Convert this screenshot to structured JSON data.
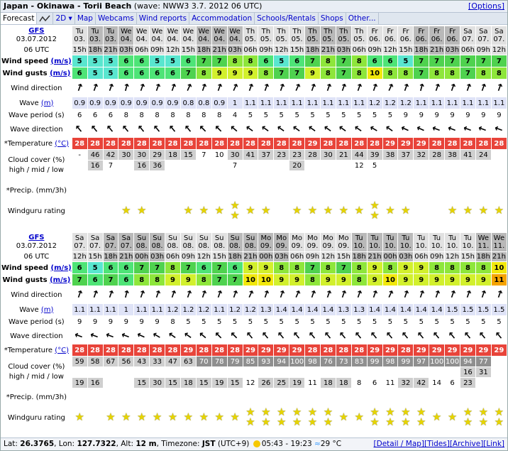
{
  "header": {
    "title_bold": "Japan - Okinawa - Torii Beach",
    "title_rest": "(wave: NWW3 3.7. 2012 06 UTC)",
    "options": "[Options]"
  },
  "tabs": [
    "Forecast",
    "2D",
    "Map",
    "Webcams",
    "Wind reports",
    "Accommodation",
    "Schools/Rentals",
    "Shops",
    "Other..."
  ],
  "labels": {
    "model": "GFS",
    "init_date": "03.07.2012",
    "init_time": "06 UTC",
    "wind_speed": "Wind speed",
    "wind_gusts": "Wind gusts",
    "ms": "(m/s)",
    "wind_direction": "Wind direction",
    "wave": "Wave",
    "m": "(m)",
    "wave_period": "Wave period (s)",
    "wave_direction": "Wave direction",
    "temperature": "*Temperature",
    "degc": "(°C)",
    "cloud1": "Cloud cover (%)",
    "cloud2": "high / mid / low",
    "precip": "*Precip. (mm/3h)",
    "rating": "Windguru rating"
  },
  "blocks": [
    {
      "days": [
        "Tu 03.",
        "Tu 03.",
        "Tu 03.",
        "We 04.",
        "We 04.",
        "We 04.",
        "We 04.",
        "We 04.",
        "We 04.",
        "We 04.",
        "We 04.",
        "Th 05.",
        "Th 05.",
        "Th 05.",
        "Th 05.",
        "Th 05.",
        "Th 05.",
        "Th 05.",
        "Th 05.",
        "Fr 06.",
        "Fr 06.",
        "Fr 06.",
        "Fr 06.",
        "Fr 06.",
        "Fr 06.",
        "Sa 07.",
        "Sa 07.",
        "Sa 07."
      ],
      "hours": [
        "15h",
        "18h",
        "21h",
        "03h",
        "06h",
        "09h",
        "12h",
        "15h",
        "18h",
        "21h",
        "03h",
        "06h",
        "09h",
        "12h",
        "15h",
        "18h",
        "21h",
        "03h",
        "06h",
        "09h",
        "12h",
        "15h",
        "18h",
        "21h",
        "03h",
        "06h",
        "09h",
        "12h"
      ],
      "wind_speed": [
        5,
        5,
        5,
        6,
        6,
        5,
        5,
        6,
        7,
        7,
        8,
        8,
        6,
        5,
        6,
        7,
        8,
        7,
        8,
        6,
        6,
        5,
        7,
        7,
        7,
        7,
        7,
        7
      ],
      "wind_gusts": [
        6,
        5,
        5,
        6,
        6,
        6,
        6,
        7,
        8,
        9,
        9,
        9,
        8,
        7,
        7,
        9,
        8,
        7,
        8,
        10,
        8,
        8,
        7,
        8,
        8,
        7,
        8,
        8
      ],
      "wind_dir": [
        20,
        20,
        20,
        15,
        20,
        20,
        20,
        25,
        20,
        20,
        25,
        20,
        20,
        20,
        25,
        20,
        20,
        20,
        20,
        20,
        25,
        20,
        15,
        20,
        20,
        20,
        20,
        20
      ],
      "wave": [
        "0.9",
        "0.9",
        "0.9",
        "0.9",
        "0.9",
        "0.9",
        "0.9",
        "0.8",
        "0.8",
        "0.9",
        "1",
        "1.1",
        "1.1",
        "1.1",
        "1.1",
        "1.1",
        "1.1",
        "1.1",
        "1.1",
        "1.2",
        "1.2",
        "1.2",
        "1.1",
        "1.1",
        "1.1",
        "1.1",
        "1.1",
        "1.1"
      ],
      "wave_period": [
        "6",
        "6",
        "6",
        "8",
        "8",
        "8",
        "8",
        "8",
        "8",
        "8",
        "4",
        "5",
        "5",
        "5",
        "5",
        "5",
        "5",
        "5",
        "5",
        "5",
        "5",
        "9",
        "9",
        "9",
        "9",
        "9",
        "9",
        "9"
      ],
      "wave_dir": [
        -40,
        -40,
        -40,
        -40,
        -40,
        -40,
        -40,
        -40,
        -45,
        -45,
        -50,
        -55,
        -55,
        -55,
        -55,
        -55,
        -55,
        -55,
        -55,
        -60,
        -55,
        -65,
        -65,
        -70,
        -70,
        -70,
        -70,
        -70
      ],
      "temperature": [
        "28",
        "28",
        "28",
        "28",
        "28",
        "28",
        "28",
        "28",
        "28",
        "28",
        "28",
        "28",
        "28",
        "28",
        "28",
        "29",
        "28",
        "28",
        "28",
        "28",
        "29",
        "29",
        "29",
        "28",
        "28",
        "28",
        "28",
        "28"
      ],
      "cloud_high": [
        "-",
        "46",
        "42",
        "30",
        "30",
        "29",
        "18",
        "15",
        "7",
        "10",
        "30",
        "41",
        "37",
        "23",
        "23",
        "28",
        "30",
        "21",
        "44",
        "39",
        "38",
        "37",
        "32",
        "28",
        "38",
        "41",
        "24",
        ""
      ],
      "cloud_mid": [
        "",
        "16",
        "7",
        "",
        "16",
        "36",
        "",
        "",
        "",
        "",
        "7",
        "",
        "",
        "",
        "20",
        "",
        "",
        "",
        "12",
        "5",
        "",
        "",
        "",
        "",
        "",
        "",
        "",
        ""
      ],
      "cloud_low": [
        "",
        "",
        "",
        "",
        "",
        "",
        "",
        "",
        "",
        "",
        "",
        "",
        "",
        "",
        "",
        "",
        "",
        "",
        "",
        "",
        "",
        "",
        "",
        "",
        "",
        "",
        "",
        ""
      ],
      "precip": [
        "",
        "",
        "",
        "",
        "",
        "",
        "",
        "",
        "",
        "",
        "",
        "",
        "",
        "",
        "",
        "",
        "",
        "",
        "",
        "",
        "",
        "",
        "",
        "",
        "",
        "",
        "",
        ""
      ],
      "rating": [
        0,
        0,
        0,
        1,
        1,
        0,
        0,
        1,
        1,
        1,
        2,
        1,
        1,
        0,
        1,
        1,
        1,
        1,
        1,
        2,
        1,
        1,
        0,
        0,
        1,
        1,
        1,
        1
      ]
    },
    {
      "days": [
        "Sa 07.",
        "Sa 07.",
        "Sa 07.",
        "Sa 07.",
        "Su 08.",
        "Su 08.",
        "Su 08.",
        "Su 08.",
        "Su 08.",
        "Su 08.",
        "Su 08.",
        "Su 08.",
        "Mo 09.",
        "Mo 09.",
        "Mo 09.",
        "Mo 09.",
        "Mo 09.",
        "Mo 09.",
        "Tu 10.",
        "Tu 10.",
        "Tu 10.",
        "Tu 10.",
        "Tu 10.",
        "Tu 10.",
        "Tu 10.",
        "Tu 10.",
        "We 11.",
        "We 11."
      ],
      "hours": [
        "12h",
        "15h",
        "18h",
        "21h",
        "00h",
        "03h",
        "06h",
        "09h",
        "12h",
        "15h",
        "18h",
        "21h",
        "00h",
        "03h",
        "06h",
        "09h",
        "12h",
        "15h",
        "18h",
        "21h",
        "00h",
        "03h",
        "06h",
        "09h",
        "12h",
        "15h",
        "18h",
        "21h"
      ],
      "wind_speed": [
        6,
        5,
        6,
        6,
        7,
        7,
        8,
        7,
        6,
        7,
        6,
        9,
        9,
        8,
        8,
        7,
        8,
        7,
        8,
        9,
        8,
        9,
        9,
        8,
        8,
        8,
        8,
        10
      ],
      "wind_gusts": [
        7,
        6,
        7,
        6,
        8,
        8,
        9,
        9,
        8,
        7,
        7,
        10,
        10,
        9,
        9,
        8,
        9,
        9,
        8,
        9,
        10,
        9,
        9,
        9,
        9,
        9,
        9,
        11
      ],
      "wind_dir": [
        20,
        20,
        20,
        15,
        20,
        20,
        20,
        20,
        20,
        20,
        20,
        25,
        20,
        20,
        25,
        20,
        20,
        20,
        20,
        20,
        25,
        20,
        20,
        20,
        20,
        20,
        20,
        20
      ],
      "wave": [
        "1.1",
        "1.1",
        "1.1",
        "1",
        "1.1",
        "1.1",
        "1.2",
        "1.2",
        "1.2",
        "1.1",
        "1.2",
        "1.2",
        "1.3",
        "1.4",
        "1.4",
        "1.4",
        "1.4",
        "1.3",
        "1.3",
        "1.4",
        "1.4",
        "1.4",
        "1.4",
        "1.4",
        "1.5",
        "1.5",
        "1.5",
        "1.5"
      ],
      "wave_period": [
        "9",
        "9",
        "9",
        "9",
        "9",
        "9",
        "8",
        "5",
        "5",
        "5",
        "5",
        "5",
        "5",
        "5",
        "5",
        "5",
        "5",
        "5",
        "5",
        "5",
        "5",
        "5",
        "5",
        "5",
        "5",
        "5",
        "5",
        "5"
      ],
      "wave_dir": [
        -70,
        -70,
        -70,
        -70,
        -65,
        -60,
        -55,
        -55,
        -50,
        -45,
        -45,
        -40,
        -40,
        -40,
        -40,
        -40,
        -40,
        -40,
        -40,
        -40,
        -40,
        -40,
        -40,
        -40,
        -40,
        -40,
        -40,
        -40
      ],
      "temperature": [
        "28",
        "28",
        "28",
        "28",
        "28",
        "28",
        "28",
        "29",
        "28",
        "28",
        "28",
        "29",
        "29",
        "29",
        "29",
        "28",
        "28",
        "28",
        "28",
        "29",
        "29",
        "28",
        "29",
        "29",
        "29",
        "29",
        "29",
        "29"
      ],
      "cloud_high": [
        "59",
        "58",
        "67",
        "56",
        "43",
        "33",
        "47",
        "63",
        "70",
        "78",
        "79",
        "85",
        "93",
        "94",
        "100",
        "98",
        "76",
        "73",
        "83",
        "99",
        "98",
        "99",
        "97",
        "100",
        "100",
        "94",
        "77",
        ""
      ],
      "cloud_mid": [
        "",
        "",
        "",
        "",
        "",
        "",
        "",
        "",
        "",
        "",
        "",
        "",
        "",
        "",
        "",
        "",
        "",
        "",
        "",
        "",
        "",
        "",
        "",
        "",
        "",
        "16",
        "31",
        ""
      ],
      "cloud_low": [
        "19",
        "16",
        "",
        "",
        "15",
        "30",
        "15",
        "18",
        "15",
        "19",
        "15",
        "12",
        "26",
        "25",
        "19",
        "11",
        "18",
        "18",
        "8",
        "6",
        "11",
        "32",
        "42",
        "14",
        "6",
        "23",
        "",
        ""
      ],
      "precip": [
        "",
        "",
        "",
        "",
        "",
        "",
        "",
        "",
        "",
        "",
        "",
        "",
        "",
        "",
        "",
        "",
        "",
        "",
        "",
        "",
        "",
        "",
        "",
        "",
        "",
        "",
        "",
        ""
      ],
      "rating": [
        1,
        0,
        1,
        1,
        1,
        1,
        1,
        1,
        1,
        1,
        1,
        2,
        2,
        2,
        2,
        2,
        2,
        1,
        1,
        2,
        2,
        2,
        2,
        1,
        1,
        2,
        2,
        2
      ]
    }
  ],
  "footer": {
    "lat_label": "Lat:",
    "lat": "26.3765",
    "lon_label": ", Lon:",
    "lon": "127.7322",
    "alt_label": ", Alt:",
    "alt": "12 m",
    "tz_label": ", Timezone:",
    "tz": "JST",
    "tz_off": "(UTC+9)",
    "sun": "05:43 - 19:23",
    "sea": "29 °C",
    "links": [
      "[Detail / Map]",
      "[Tides]",
      "[Archive]",
      "[Link]"
    ]
  },
  "colors": {
    "temp": "#e8443a",
    "wave_bg": "#dfe3f7",
    "star": "#e6d400"
  }
}
